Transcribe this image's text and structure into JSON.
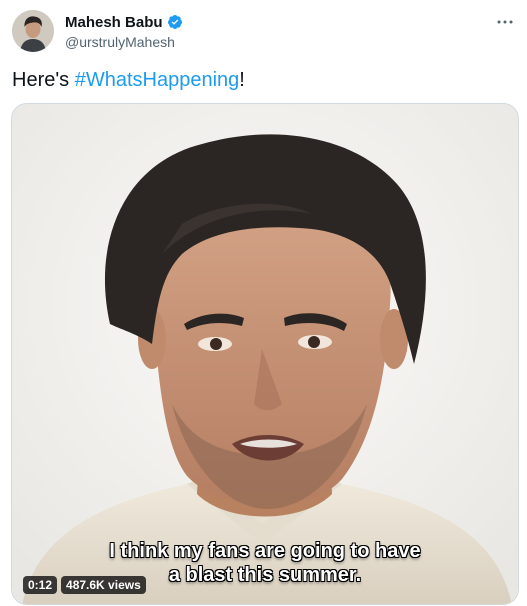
{
  "author": {
    "display_name": "Mahesh Babu",
    "handle": "@urstrulyMahesh",
    "verified": true,
    "verified_color": "#1d9bf0"
  },
  "tweet": {
    "text_prefix": "Here's ",
    "hashtag": "#WhatsHappening",
    "text_suffix": "!"
  },
  "video": {
    "subtitle_line1": "I think my fans are going to have",
    "subtitle_line2": "a blast this summer.",
    "duration": "0:12",
    "views": "487.6K views"
  },
  "colors": {
    "link": "#1d9bf0",
    "secondary_text": "#536471",
    "border": "#cfd9de"
  },
  "icons": {
    "more": "more-horizontal-icon",
    "verified": "verified-badge-icon"
  }
}
